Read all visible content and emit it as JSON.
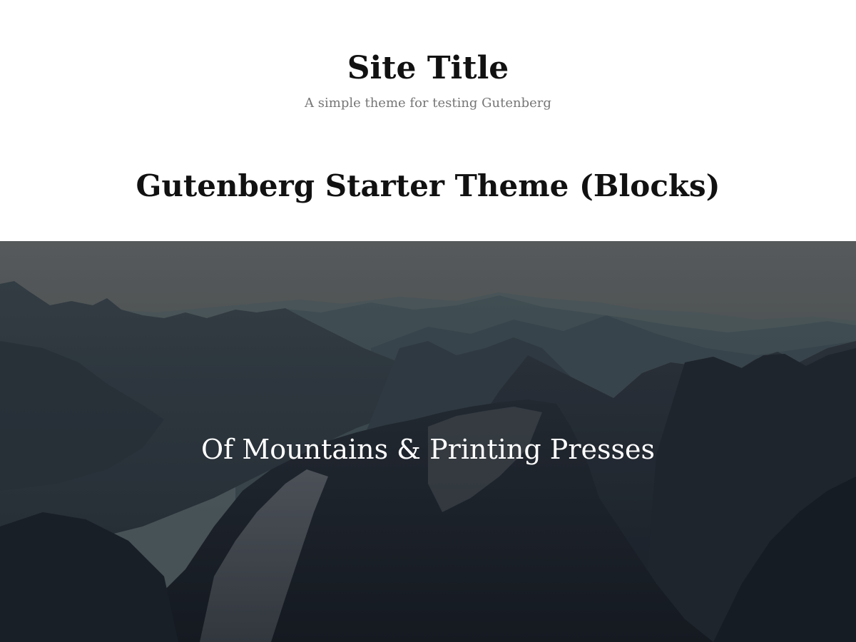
{
  "site": {
    "title": "Site Title",
    "tagline": "A simple theme for testing Gutenberg"
  },
  "page": {
    "title": "Gutenberg Starter Theme (Blocks)"
  },
  "cover": {
    "text": "Of Mountains & Printing Presses",
    "image_subject": "mountain range landscape"
  },
  "colors": {
    "title": "#111111",
    "tagline": "#767676",
    "cover_text": "#ffffff",
    "background": "#ffffff"
  }
}
